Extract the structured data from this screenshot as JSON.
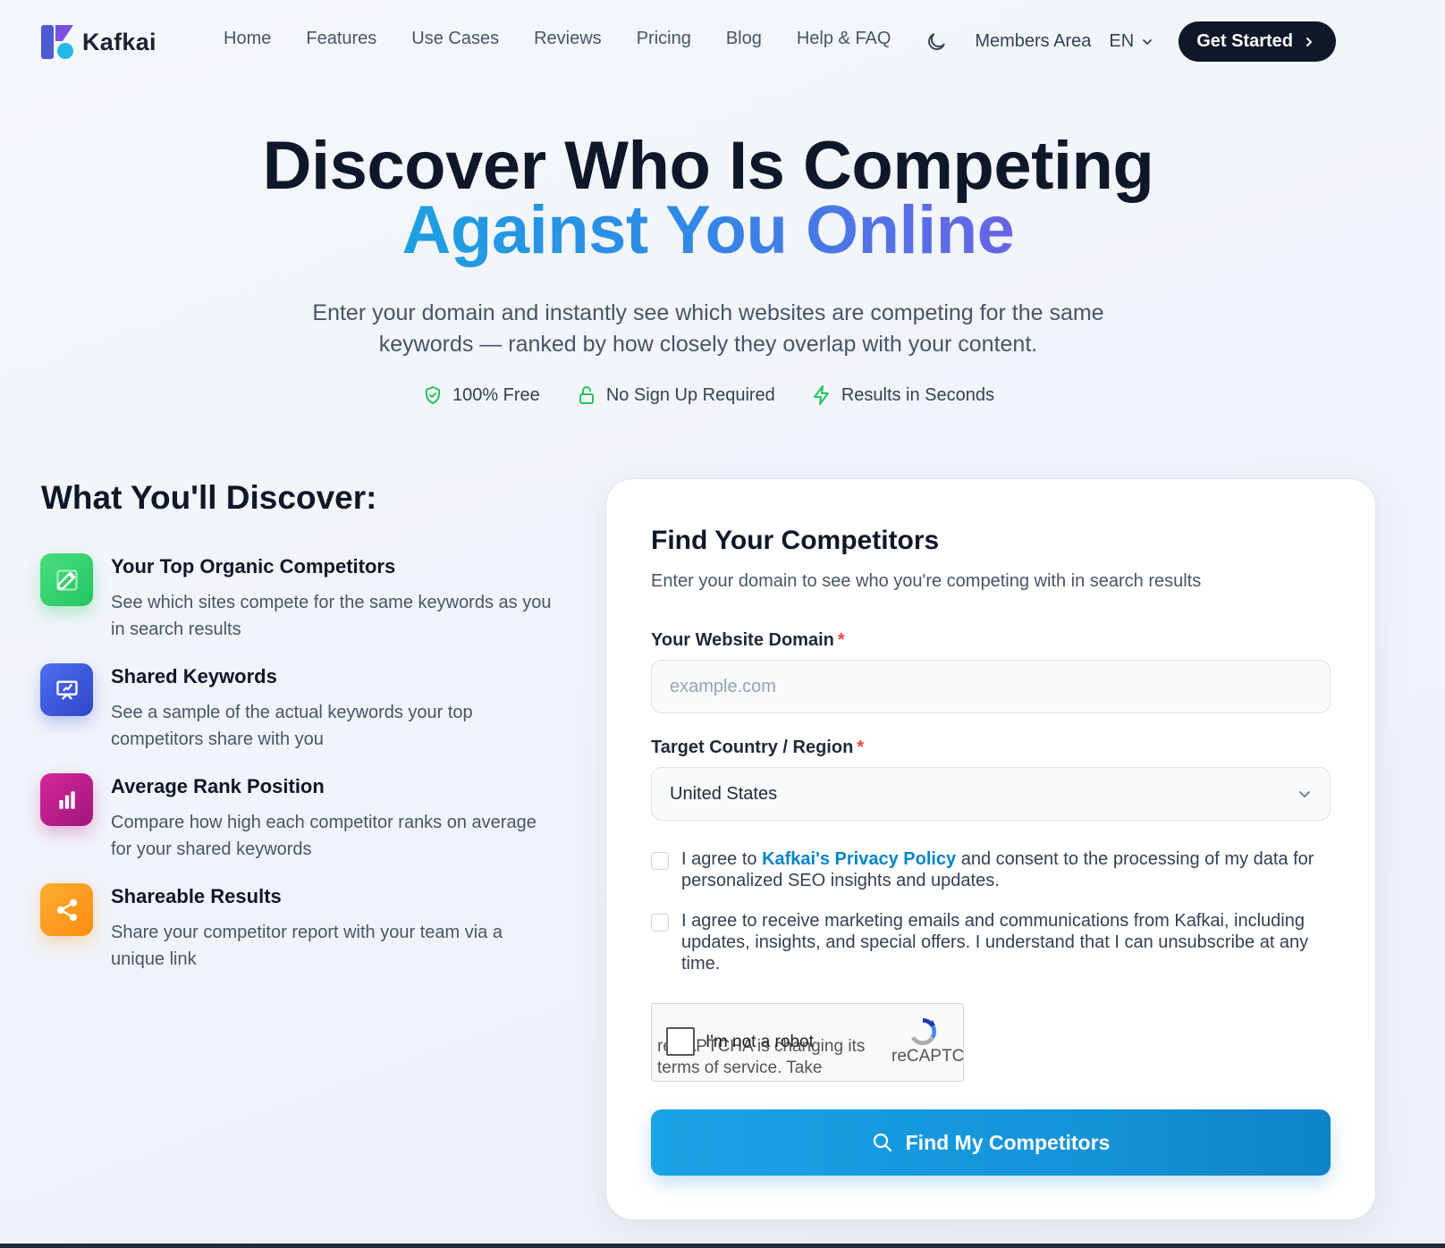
{
  "brand": {
    "name": "Kafkai",
    "colors": {
      "primary": "#4f5bd5",
      "accent": "#22b8e8",
      "dark": "#0f172a"
    }
  },
  "nav": {
    "items": [
      "Home",
      "Features",
      "Use Cases",
      "Reviews",
      "Pricing",
      "Blog",
      "Help & FAQ"
    ],
    "theme_icon": "moon-icon",
    "members": "Members Area",
    "lang": "EN",
    "cta": "Get Started"
  },
  "hero": {
    "title_line1": "Discover Who Is Competing",
    "title_line2": "Against You Online",
    "subtitle": "Enter your domain and instantly see which websites are competing for the same keywords — ranked by how closely they overlap with your content.",
    "badges": [
      {
        "icon": "shield-check-icon",
        "label": "100% Free"
      },
      {
        "icon": "lock-icon",
        "label": "No Sign Up Required"
      },
      {
        "icon": "lightning-icon",
        "label": "Results in Seconds"
      }
    ]
  },
  "discover": {
    "title": "What You'll Discover:",
    "features": [
      {
        "icon": "edit-icon",
        "color": "#34d07a",
        "title": "Your Top Organic Competitors",
        "desc": "See which sites compete for the same keywords as you in search results"
      },
      {
        "icon": "presentation-icon",
        "color": "#3b5bdb",
        "title": "Shared Keywords",
        "desc": "See a sample of the actual keywords your top competitors share with you"
      },
      {
        "icon": "bar-chart-icon",
        "color": "#c0208a",
        "title": "Average Rank Position",
        "desc": "Compare how high each competitor ranks on average for your shared keywords"
      },
      {
        "icon": "share-icon",
        "color": "#fb9a1a",
        "title": "Shareable Results",
        "desc": "Share your competitor report with your team via a unique link"
      }
    ]
  },
  "form": {
    "title": "Find Your Competitors",
    "subtitle": "Enter your domain to see who you're competing with in search results",
    "domain_label": "Your Website Domain",
    "domain_placeholder": "example.com",
    "domain_value": "",
    "required_mark": "*",
    "country_label": "Target Country / Region",
    "country_value": "United States",
    "consent1_pre": "I agree to ",
    "consent1_link": "Kafkai's Privacy Policy",
    "consent1_post": " and consent to the processing of my data for personalized SEO insights and updates.",
    "consent2": "I agree to receive marketing emails and communications from Kafkai, including updates, insights, and special offers. I understand that I can unsubscribe at any time.",
    "recaptcha_label": "I'm not a robot",
    "recaptcha_notice": "reCAPTCHA is changing its terms of service. Take action.",
    "recaptcha_brand": "reCAPTCHA",
    "submit": "Find My Competitors"
  }
}
